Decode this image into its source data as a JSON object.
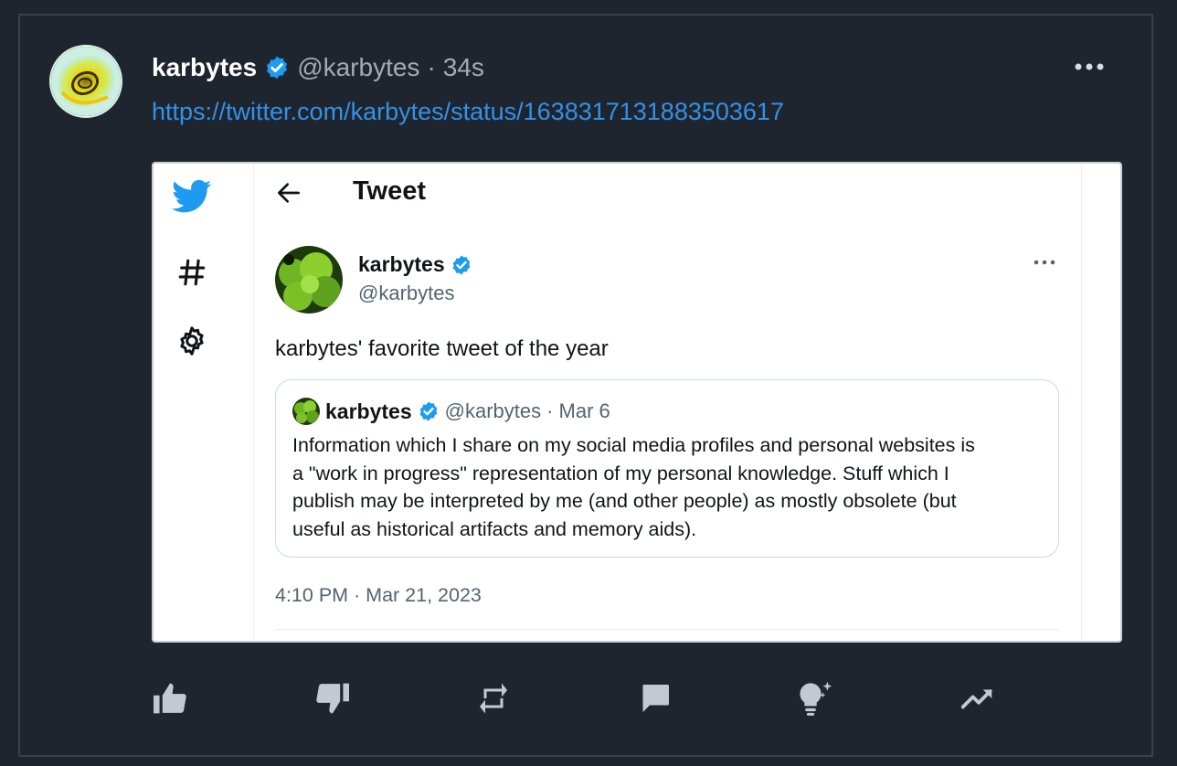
{
  "post": {
    "author_name": "karbytes",
    "author_handle": "@karbytes",
    "separator": "·",
    "time_ago": "34s",
    "link": "https://twitter.com/karbytes/status/1638317131883503617"
  },
  "embed": {
    "page_title": "Tweet",
    "tweet": {
      "name": "karbytes",
      "handle": "@karbytes",
      "text": "karbytes' favorite tweet of the year",
      "timestamp": "4:10 PM · Mar 21, 2023"
    },
    "quote": {
      "name": "karbytes",
      "handle": "@karbytes",
      "date": "· Mar 6",
      "lines": [
        "Information which I share on my social media profiles and personal websites is",
        "a \"work in progress\" representation of my personal knowledge. Stuff which I",
        "publish may be interpreted by me (and other people) as mostly obsolete (but",
        "useful as historical artifacts and memory aids)."
      ]
    }
  },
  "colors": {
    "background": "#1f252e",
    "link": "#3391e8",
    "verified": "#1d9bf0",
    "icon": "#b9c0ca"
  },
  "icons": [
    "verified-badge-icon",
    "more-horizontal-icon",
    "twitter-bird-icon",
    "hashtag-icon",
    "gear-icon",
    "back-arrow-icon",
    "thumbs-up-icon",
    "thumbs-down-icon",
    "repost-icon",
    "comment-icon",
    "idea-bulb-icon",
    "trending-icon"
  ]
}
